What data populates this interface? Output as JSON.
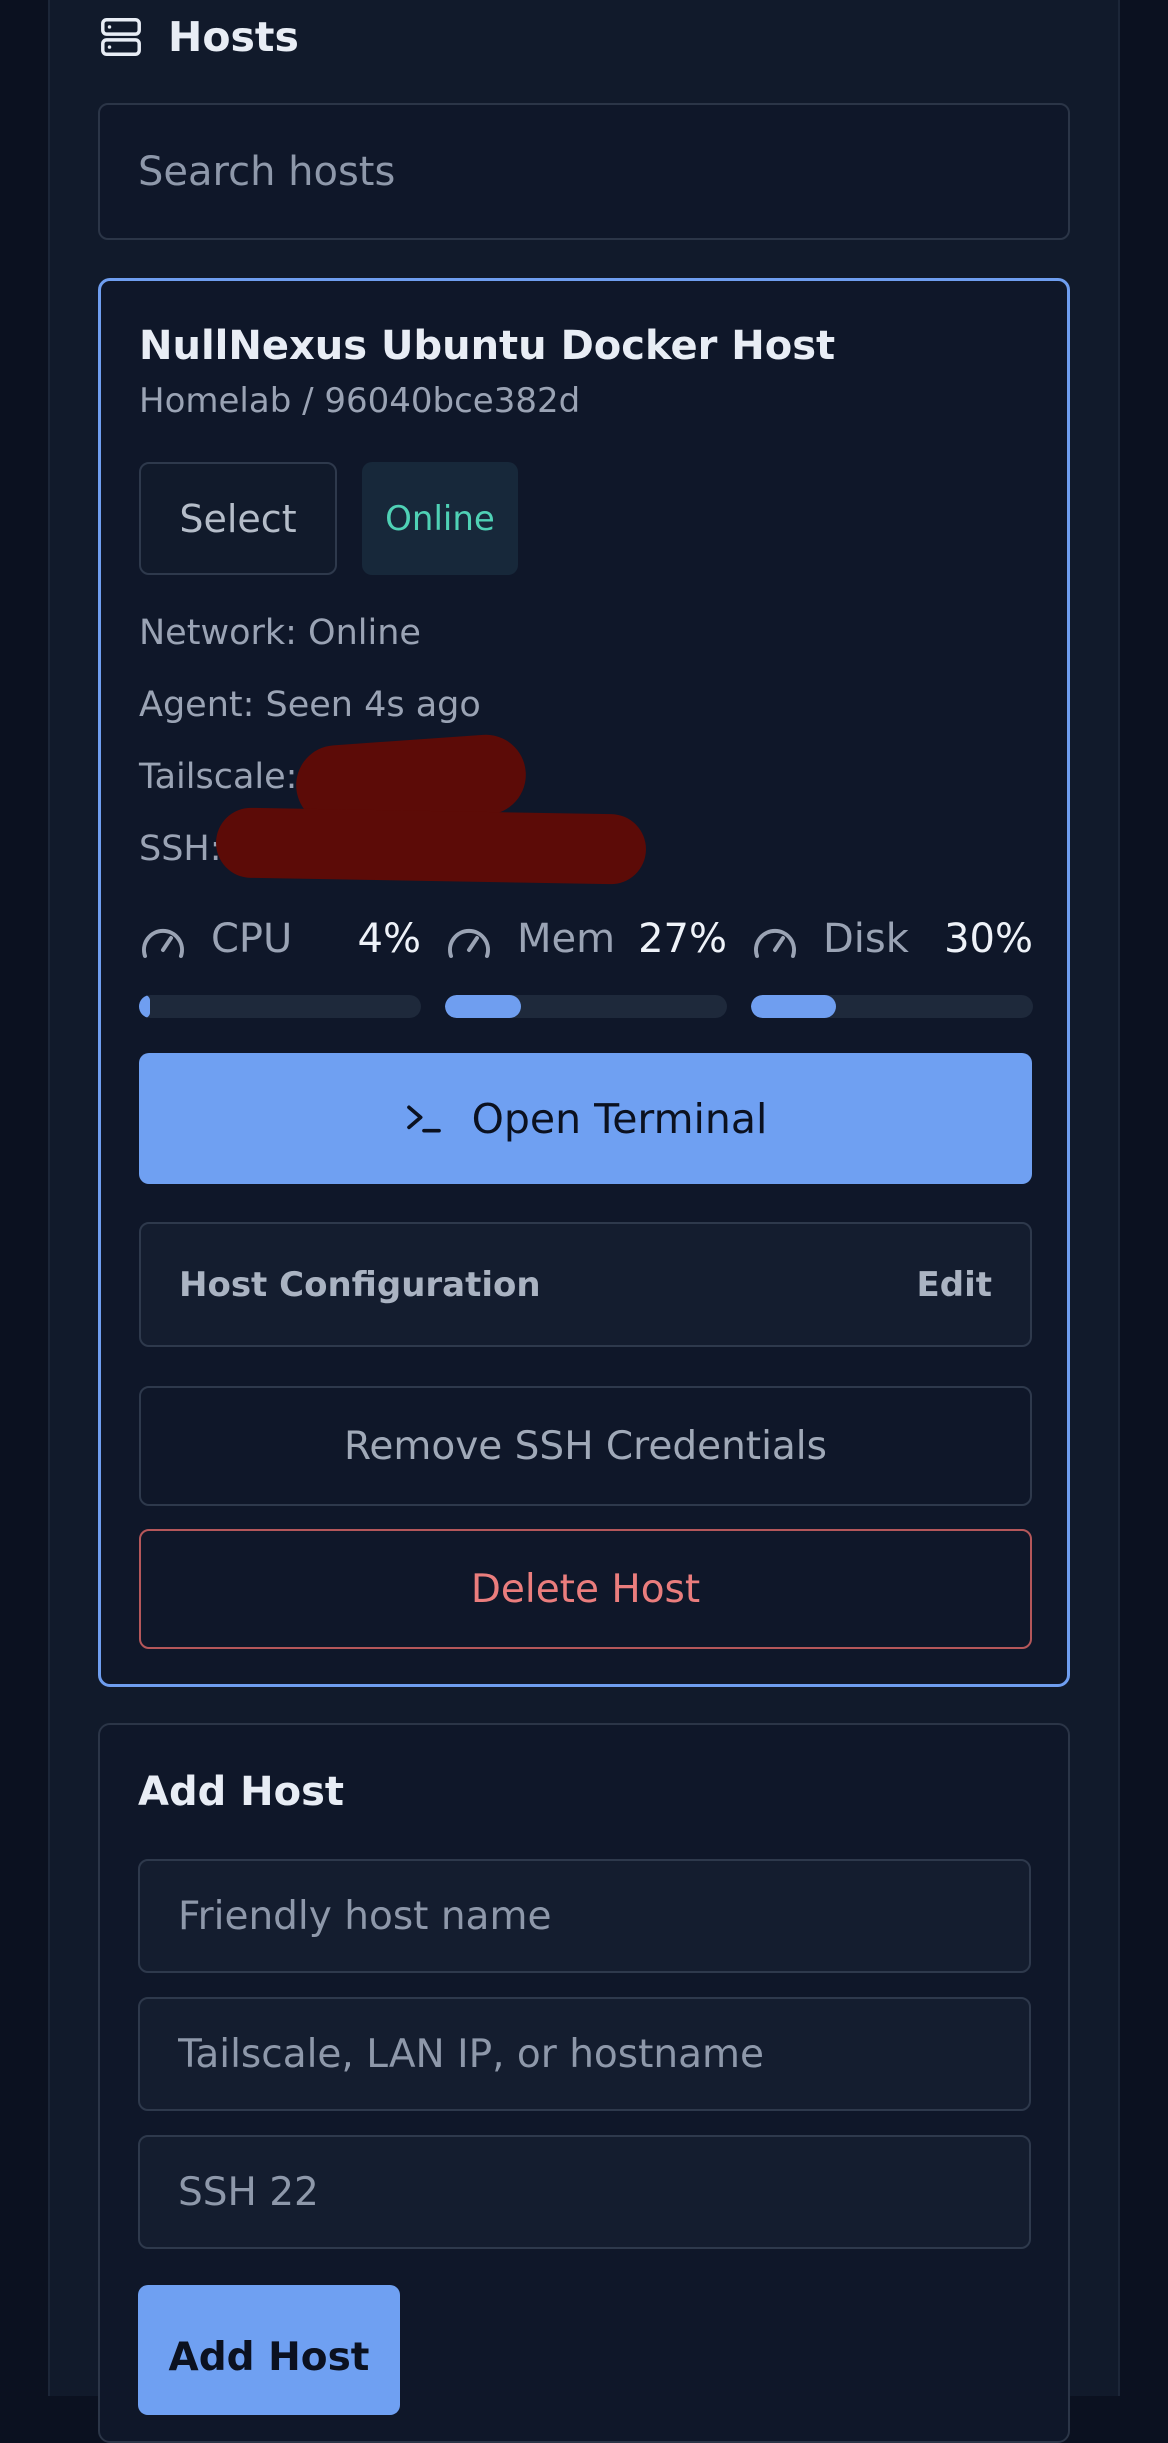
{
  "header": {
    "title": "Hosts",
    "icon": "server-icon"
  },
  "search": {
    "placeholder": "Search hosts",
    "value": ""
  },
  "host": {
    "name": "NullNexus Ubuntu Docker Host",
    "subtitle": "Homelab / 96040bce382d",
    "select_label": "Select",
    "status": "Online",
    "status_color": "#4fd1b5",
    "network": "Network: Online",
    "agent": "Agent: Seen 4s ago",
    "tailscale_label": "Tailscale:",
    "ssh_label": "SSH:",
    "metrics": [
      {
        "label": "CPU",
        "value": "4%",
        "percent": 4,
        "icon": "gauge-icon"
      },
      {
        "label": "Mem",
        "value": "27%",
        "percent": 27,
        "icon": "gauge-icon"
      },
      {
        "label": "Disk",
        "value": "30%",
        "percent": 30,
        "icon": "gauge-icon"
      }
    ],
    "terminal_label": "Open Terminal",
    "terminal_icon": "terminal-icon",
    "config_title": "Host Configuration",
    "config_edit": "Edit",
    "remove_ssh_label": "Remove SSH Credentials",
    "delete_label": "Delete Host"
  },
  "add_host": {
    "title": "Add Host",
    "name_placeholder": "Friendly host name",
    "address_placeholder": "Tailscale, LAN IP, or hostname",
    "port_placeholder": "SSH 22",
    "submit_label": "Add Host"
  },
  "colors": {
    "accent": "#6fa0f2",
    "danger": "#ea7d7d",
    "background": "#0b1120",
    "panel": "#111a2b"
  }
}
